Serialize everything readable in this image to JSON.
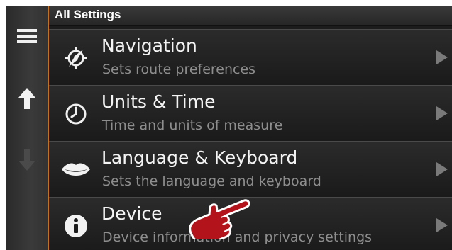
{
  "header": {
    "title": "All Settings"
  },
  "rail": {
    "menu_icon": "hamburger-menu-icon",
    "up_icon": "arrow-up-icon",
    "down_icon": "arrow-down-icon"
  },
  "settings": [
    {
      "icon": "navigation-compass-icon",
      "title": "Navigation",
      "subtitle": "Sets route preferences"
    },
    {
      "icon": "clock-icon",
      "title": "Units & Time",
      "subtitle": "Time and units of measure"
    },
    {
      "icon": "lips-icon",
      "title": "Language & Keyboard",
      "subtitle": "Sets the language and keyboard"
    },
    {
      "icon": "info-icon",
      "title": "Device",
      "subtitle": "Device information and privacy settings"
    }
  ],
  "colors": {
    "accent": "#c8701a",
    "background": "#1c1c1c",
    "title_text": "#f4f4f4",
    "subtitle_text": "#8e8e8e",
    "pointer": "#b3141c"
  },
  "pointer_icon": "pointing-hand-icon"
}
